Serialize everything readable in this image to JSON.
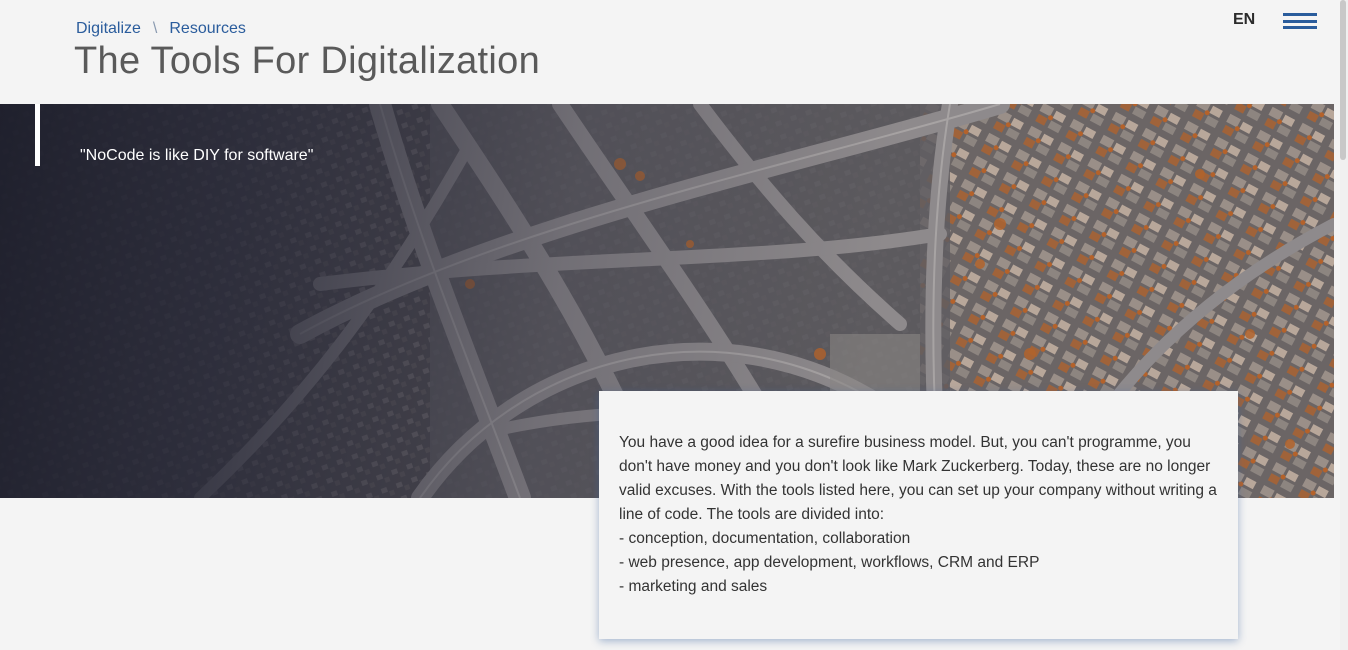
{
  "breadcrumb": {
    "items": [
      "Digitalize",
      "Resources"
    ],
    "separator": "\\"
  },
  "page_title": "The Tools For Digitalization",
  "header": {
    "language": "EN",
    "menu_icon": "hamburger-menu-icon"
  },
  "hero": {
    "quote": "\"NoCode is like DIY for software\"",
    "image_description_icon": "aerial-highway-photo"
  },
  "intro": {
    "text": "You have a good idea for a surefire business model. But, you can't programme, you don't have money and you don't look like Mark Zuckerberg. Today, these are no longer valid excuses. With the tools listed here, you can set up your company without writing a line of code. The tools are divided into:",
    "list": [
      "- conception, documentation, collaboration",
      "- web presence, app development, workflows, CRM and ERP",
      "- marketing and sales"
    ]
  },
  "colors": {
    "accent": "#2a5c9c",
    "background": "#f4f4f4",
    "title": "#5a5a5a"
  }
}
